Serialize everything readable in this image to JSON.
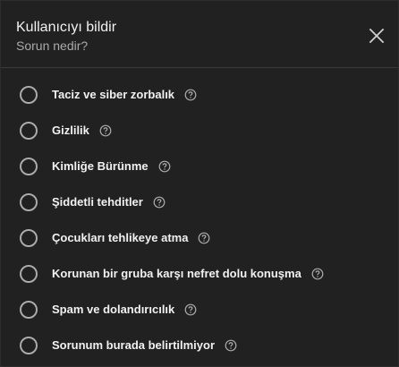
{
  "dialog": {
    "title": "Kullanıcıyı bildir",
    "subtitle": "Sorun nedir?",
    "close_icon": "close-icon",
    "options": [
      {
        "label": "Taciz ve siber zorbalık",
        "selected": false,
        "help_icon": "help-icon"
      },
      {
        "label": "Gizlilik",
        "selected": false,
        "help_icon": "help-icon"
      },
      {
        "label": "Kimliğe Bürünme",
        "selected": false,
        "help_icon": "help-icon"
      },
      {
        "label": "Şiddetli tehditler",
        "selected": false,
        "help_icon": "help-icon"
      },
      {
        "label": "Çocukları tehlikeye atma",
        "selected": false,
        "help_icon": "help-icon"
      },
      {
        "label": "Korunan bir gruba karşı nefret dolu konuşma",
        "selected": false,
        "help_icon": "help-icon"
      },
      {
        "label": "Spam ve dolandırıcılık",
        "selected": false,
        "help_icon": "help-icon"
      },
      {
        "label": "Sorunum burada belirtilmiyor",
        "selected": false,
        "help_icon": "help-icon"
      }
    ]
  },
  "colors": {
    "background": "#212121",
    "text_primary": "#f1f1f1",
    "text_secondary": "#aaaaaa",
    "divider": "#3a3a3a"
  }
}
